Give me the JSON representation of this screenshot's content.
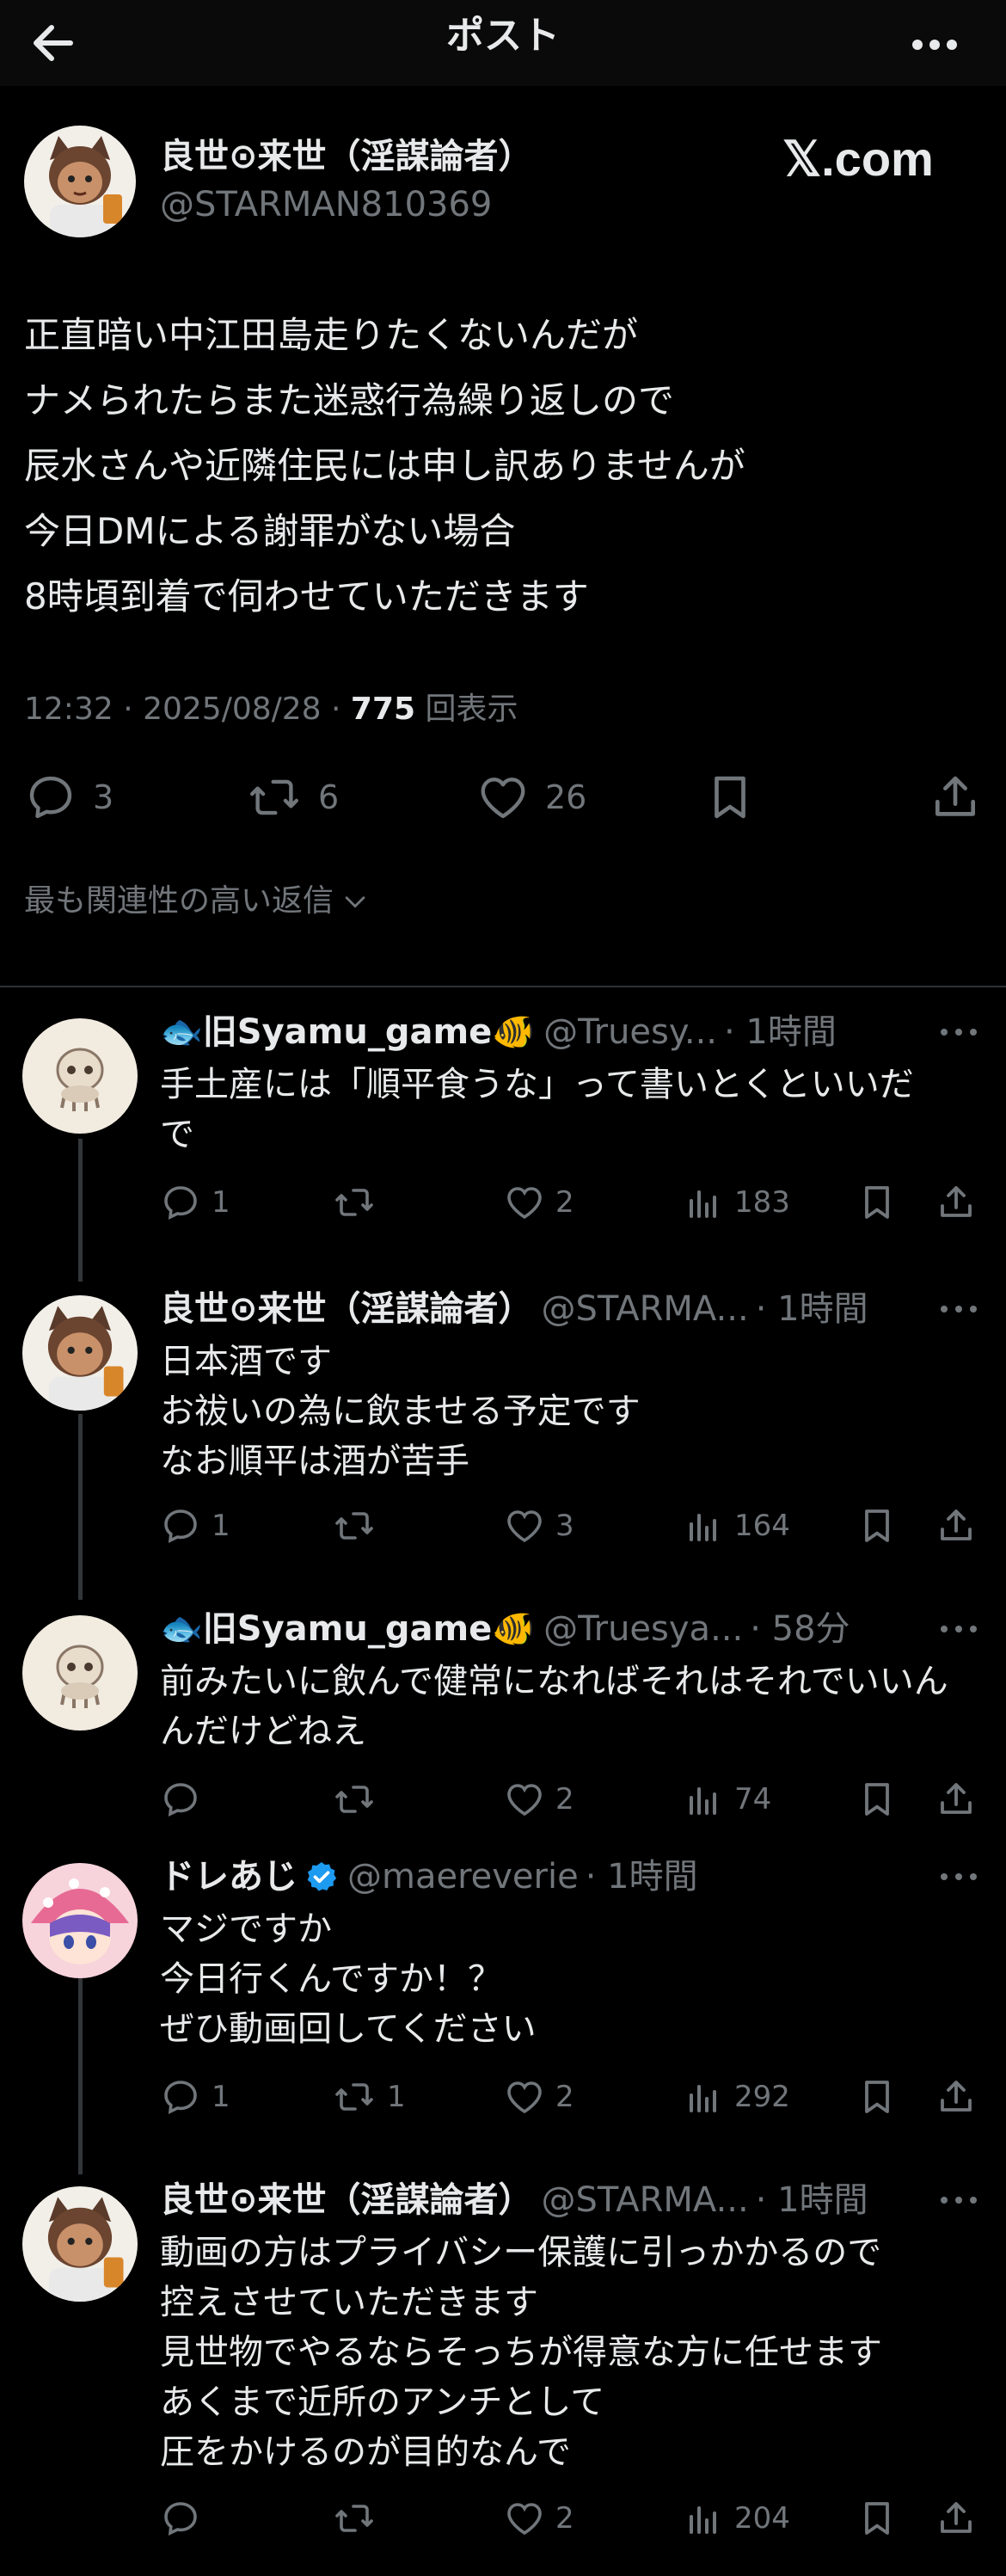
{
  "header": {
    "title": "ポスト"
  },
  "tweet": {
    "name": "良世⊙来世（淫謀論者）",
    "handle": "@STARMAN810369",
    "brand": "𝕏.com",
    "lines": [
      "正直暗い中江田島走りたくないんだが",
      "ナメられたらまた迷惑行為繰り返しので",
      "辰水さんや近隣住民には申し訳ありませんが",
      "今日DMによる謝罪がない場合",
      "8時頃到着で伺わせていただきます"
    ],
    "time": "12:32 · 2025/08/28 · ",
    "views_count": "775",
    "views_label": " 回表示",
    "replies": "3",
    "retweets": "6",
    "likes": "26",
    "sort_label": "最も関連性の高い返信"
  },
  "replies": [
    {
      "name": "🐟旧Syamu_game🐠",
      "handle": "@Truesy...",
      "time": "· 1時間",
      "lines": [
        "手土産には「順平食うな」って書いとくといいだ",
        "で"
      ],
      "replies": "1",
      "retweets": "",
      "likes": "2",
      "views": "183"
    },
    {
      "name": "良世⊙来世（淫謀論者）",
      "handle": "@STARMA...",
      "time": "· 1時間",
      "lines": [
        "日本酒です",
        "お祓いの為に飲ませる予定です",
        "なお順平は酒が苦手"
      ],
      "replies": "1",
      "retweets": "",
      "likes": "3",
      "views": "164"
    },
    {
      "name": "🐟旧Syamu_game🐠",
      "handle": "@Truesya...",
      "time": "· 58分",
      "lines": [
        "前みたいに飲んで健常になればそれはそれでいいん",
        "んだけどねえ"
      ],
      "replies": "",
      "retweets": "",
      "likes": "2",
      "views": "74"
    },
    {
      "name": "ドレあじ",
      "handle": "@maereverie",
      "time": "· 1時間",
      "lines": [
        "マジですか",
        "今日行くんですか！？",
        "ぜひ動画回してください"
      ],
      "replies": "1",
      "retweets": "1",
      "likes": "2",
      "views": "292"
    },
    {
      "name": "良世⊙来世（淫謀論者）",
      "handle": "@STARMA...",
      "time": "· 1時間",
      "lines": [
        "動画の方はプライバシー保護に引っかかるので",
        "控えさせていただきます",
        "見世物でやるならそっちが得意な方に任せます",
        "あくまで近所のアンチとして",
        "圧をかけるのが目的なんで"
      ],
      "replies": "",
      "retweets": "",
      "likes": "2",
      "views": "204"
    }
  ],
  "colors": {
    "background": "#000000",
    "text": "#e7e9ea",
    "muted": "#71767b",
    "verified": "#1d9bf0"
  }
}
